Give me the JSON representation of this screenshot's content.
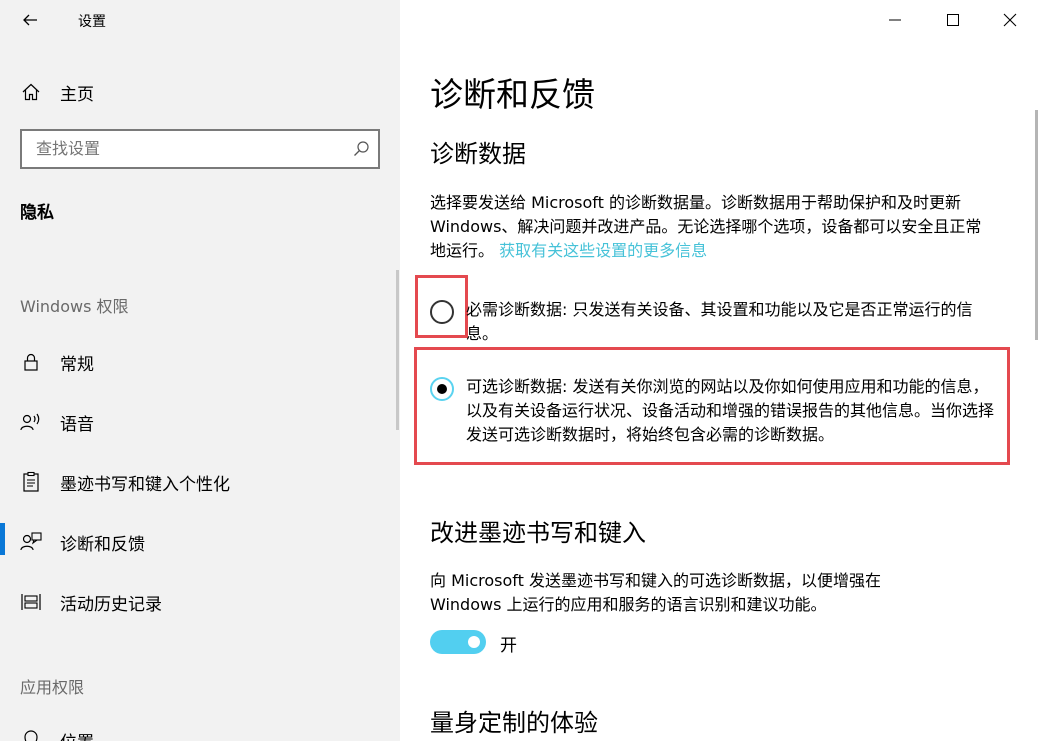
{
  "app": {
    "title": "设置"
  },
  "sidebar": {
    "home_label": "主页",
    "search_placeholder": "查找设置",
    "section_title": "隐私",
    "group_windows": "Windows 权限",
    "group_app": "应用权限",
    "items": [
      {
        "label": "常规",
        "icon": "lock-icon"
      },
      {
        "label": "语音",
        "icon": "speech-icon"
      },
      {
        "label": "墨迹书写和键入个性化",
        "icon": "clipboard-icon"
      },
      {
        "label": "诊断和反馈",
        "icon": "feedback-icon",
        "active": true
      },
      {
        "label": "活动历史记录",
        "icon": "history-icon"
      },
      {
        "label": "位置",
        "icon": "location-icon"
      }
    ]
  },
  "main": {
    "page_title": "诊断和反馈",
    "diag_heading": "诊断数据",
    "diag_desc": "选择要发送给 Microsoft 的诊断数据量。诊断数据用于帮助保护和及时更新 Windows、解决问题并改进产品。无论选择哪个选项，设备都可以安全且正常地运行。",
    "diag_link": "获取有关这些设置的更多信息",
    "option_required": "必需诊断数据: 只发送有关设备、其设置和功能以及它是否正常运行的信息。",
    "option_optional": "可选诊断数据: 发送有关你浏览的网站以及你如何使用应用和功能的信息，以及有关设备运行状况、设备活动和增强的错误报告的其他信息。当你选择发送可选诊断数据时，将始终包含必需的诊断数据。",
    "ink_heading": "改进墨迹书写和键入",
    "ink_desc": "向 Microsoft 发送墨迹书写和键入的可选诊断数据，以便增强在 Windows 上运行的应用和服务的语言识别和建议功能。",
    "toggle_label": "开",
    "tailored_heading": "量身定制的体验"
  },
  "colors": {
    "accent": "#0a78d7",
    "toggle_on": "#52cff0",
    "highlight": "#e4494f",
    "link": "#46c2d8"
  }
}
